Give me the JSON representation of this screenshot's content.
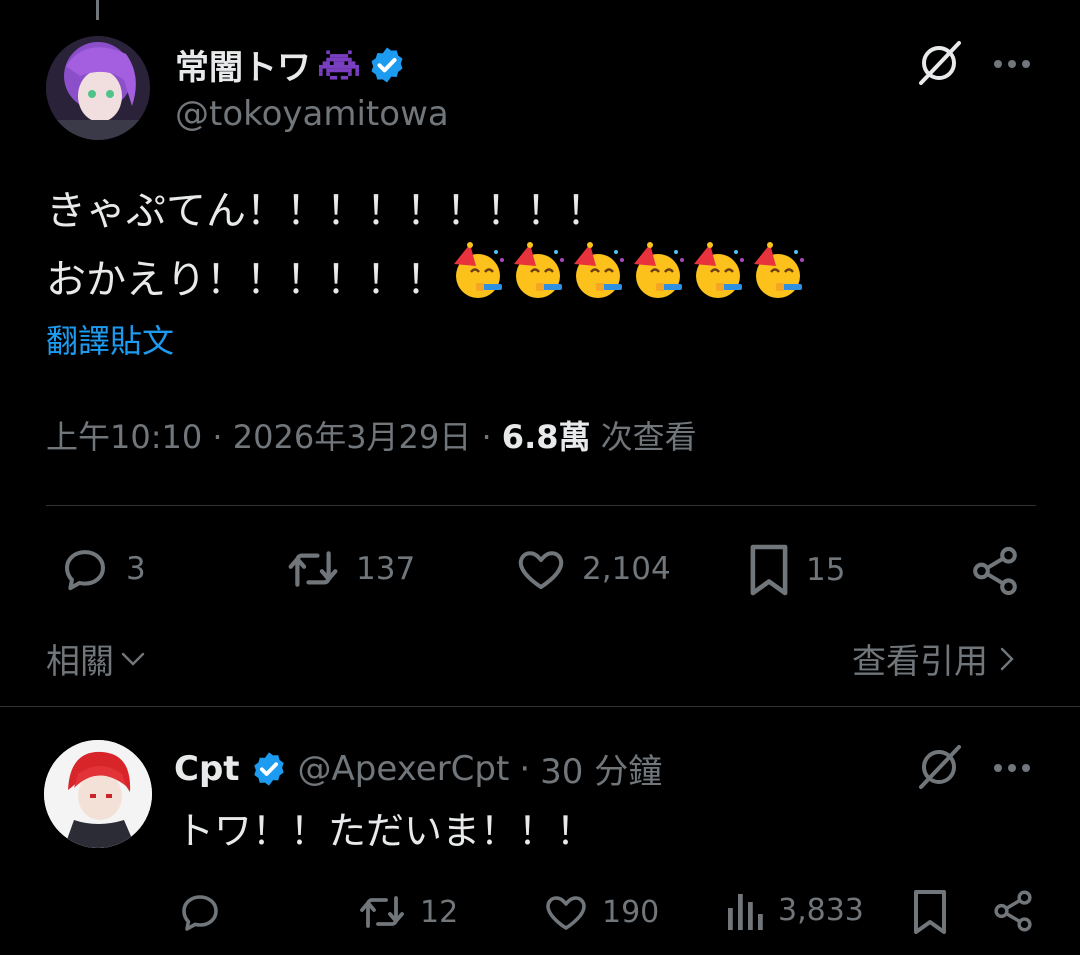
{
  "colors": {
    "background": "#000000",
    "text": "#e7e9ea",
    "muted": "#71767b",
    "link": "#1d9bf0",
    "verified": "#1d9bf0"
  },
  "main_post": {
    "display_name": "常闇トワ",
    "handle": "@tokoyamitowa",
    "text_line1": "きゃぷてん！！！！！！！！！",
    "text_line2": "おかえり！！！！！！",
    "emoji_name": "partying-face-emoji",
    "translate_label": "翻譯貼文",
    "time": "上午10:10",
    "date": "2026年3月29日",
    "views_count": "6.8萬",
    "views_label": "次查看",
    "replies": "3",
    "reposts": "137",
    "likes": "2,104",
    "bookmarks": "15",
    "related_label": "相關",
    "quotes_label": "查看引用"
  },
  "reply": {
    "display_name": "Cpt",
    "handle": "@ApexerCpt",
    "time": "30 分鐘",
    "text": "トワ！！ただいま！！！",
    "reposts": "12",
    "likes": "190",
    "views": "3,833"
  }
}
